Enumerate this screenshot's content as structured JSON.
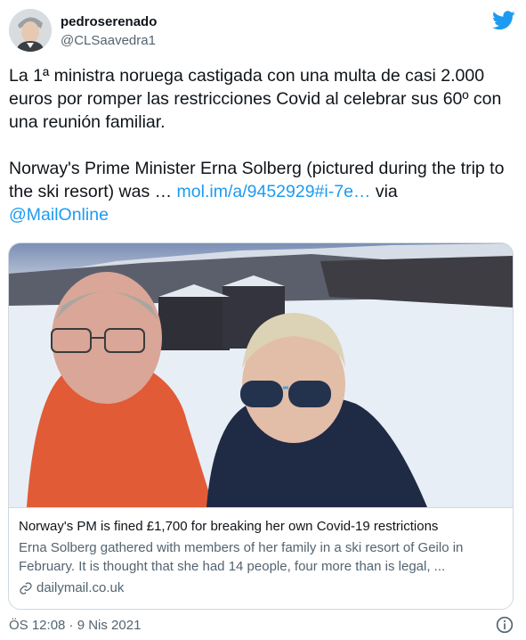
{
  "user": {
    "display_name": "pedroserenado",
    "handle": "@CLSaavedra1",
    "avatar_icon": "user-avatar"
  },
  "brand": {
    "twitter_blue": "#1d9bf0",
    "logo_icon": "twitter-bird-icon"
  },
  "tweet": {
    "text_part1": "La 1ª ministra noruega castigada con una multa de casi 2.000 euros por romper las restricciones Covid al celebrar sus 60º con una reunión familiar.\n\nNorway's Prime Minister Erna Solberg (pictured during the trip to the ski resort) was … ",
    "link_text": "mol.im/a/9452929#i-7e…",
    "text_part2": " via",
    "mention": "@MailOnline"
  },
  "card": {
    "title": "Norway's PM is fined £1,700 for breaking her own Covid-19 restrictions",
    "description": "Erna Solberg gathered with members of her family in a ski resort of Geilo in February. It is thought that she had 14 people, four more than is legal, ...",
    "domain": "dailymail.co.uk",
    "link_icon": "link-icon"
  },
  "footer": {
    "timestamp": "ÖS 12:08 · 9 Nis 2021",
    "info_icon": "info-icon"
  }
}
